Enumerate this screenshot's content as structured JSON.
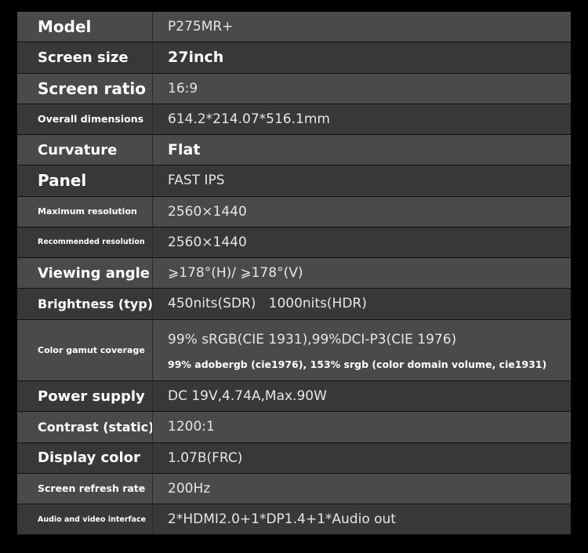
{
  "specs": [
    {
      "label": "Model",
      "value": "P275MR+"
    },
    {
      "label": "Screen size",
      "value": "27inch"
    },
    {
      "label": "Screen ratio",
      "value": "16:9"
    },
    {
      "label": "Overall dimensions",
      "value": "614.2*214.07*516.1mm"
    },
    {
      "label": "Curvature",
      "value": "Flat"
    },
    {
      "label": "Panel",
      "value": "FAST IPS"
    },
    {
      "label": "Maximum resolution",
      "value": "2560×1440"
    },
    {
      "label": "Recommended resolution",
      "value": "2560×1440"
    },
    {
      "label": "Viewing angle",
      "value": "⩾178°(H)/ ⩾178°(V)"
    },
    {
      "label": "Brightness (typ)",
      "value": "450nits(SDR)   1000nits(HDR)"
    },
    {
      "label": "Color gamut coverage",
      "value": "99% sRGB(CIE 1931),99%DCI-P3(CIE 1976)",
      "value2": "99% adobergb (cie1976), 153% srgb (color domain volume, cie1931)"
    },
    {
      "label": "Power supply",
      "value": "DC 19V,4.74A,Max.90W"
    },
    {
      "label": "Contrast (static)",
      "value": "1200:1"
    },
    {
      "label": "Display color",
      "value": "1.07B(FRC)"
    },
    {
      "label": "Screen refresh rate",
      "value": "200Hz"
    },
    {
      "label": "Audio and video interface",
      "value": "2*HDMI2.0+1*DP1.4+1*Audio out"
    }
  ]
}
